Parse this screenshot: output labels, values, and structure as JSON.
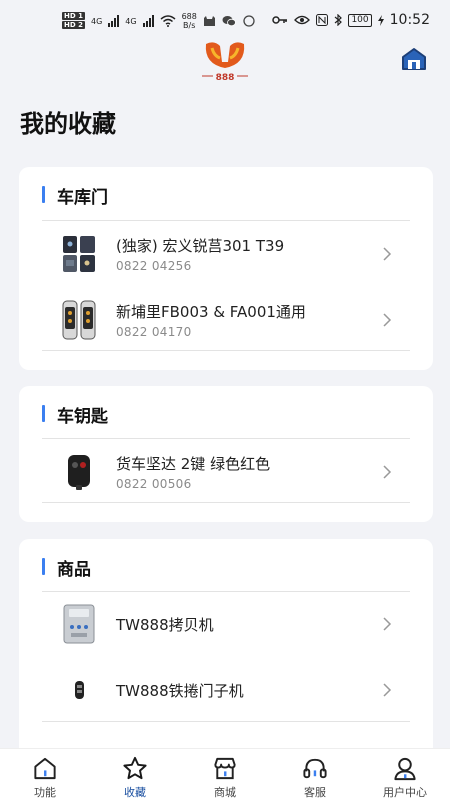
{
  "status_bar": {
    "sim1": "HD 1",
    "sim2": "HD 2",
    "net_type_1": "4G",
    "net_type_2": "4G",
    "speed_value": "688",
    "speed_unit": "B/s",
    "battery": "100",
    "time": "10:52"
  },
  "page_title": "我的收藏",
  "logo_text": "888",
  "sections": [
    {
      "title": "车库门",
      "items": [
        {
          "name": "(独家) 宏义锐莒301 T39",
          "code": "0822 04256",
          "thumb": "garage-remote-1"
        },
        {
          "name": "新埔里FB003 & FA001通用",
          "code": "0822 04170",
          "thumb": "garage-remote-2"
        }
      ]
    },
    {
      "title": "车钥匙",
      "items": [
        {
          "name": "货车坚达 2键 绿色红色",
          "code": "0822 00506",
          "thumb": "car-key"
        }
      ]
    },
    {
      "title": "商品",
      "items": [
        {
          "name": "TW888拷贝机",
          "code": "",
          "thumb": "copier-device"
        },
        {
          "name": "TW888铁捲门子机",
          "code": "",
          "thumb": "rolling-door-remote"
        }
      ]
    }
  ],
  "tabs": [
    {
      "label": "功能",
      "icon": "home-icon",
      "active": false
    },
    {
      "label": "收藏",
      "icon": "star-icon",
      "active": true
    },
    {
      "label": "商城",
      "icon": "shop-icon",
      "active": false
    },
    {
      "label": "客服",
      "icon": "headset-icon",
      "active": false
    },
    {
      "label": "用户中心",
      "icon": "user-icon",
      "active": false
    }
  ],
  "colors": {
    "accent": "#3b7ff0",
    "active_tab": "#1a4fa0",
    "background": "#f2f3f7"
  }
}
